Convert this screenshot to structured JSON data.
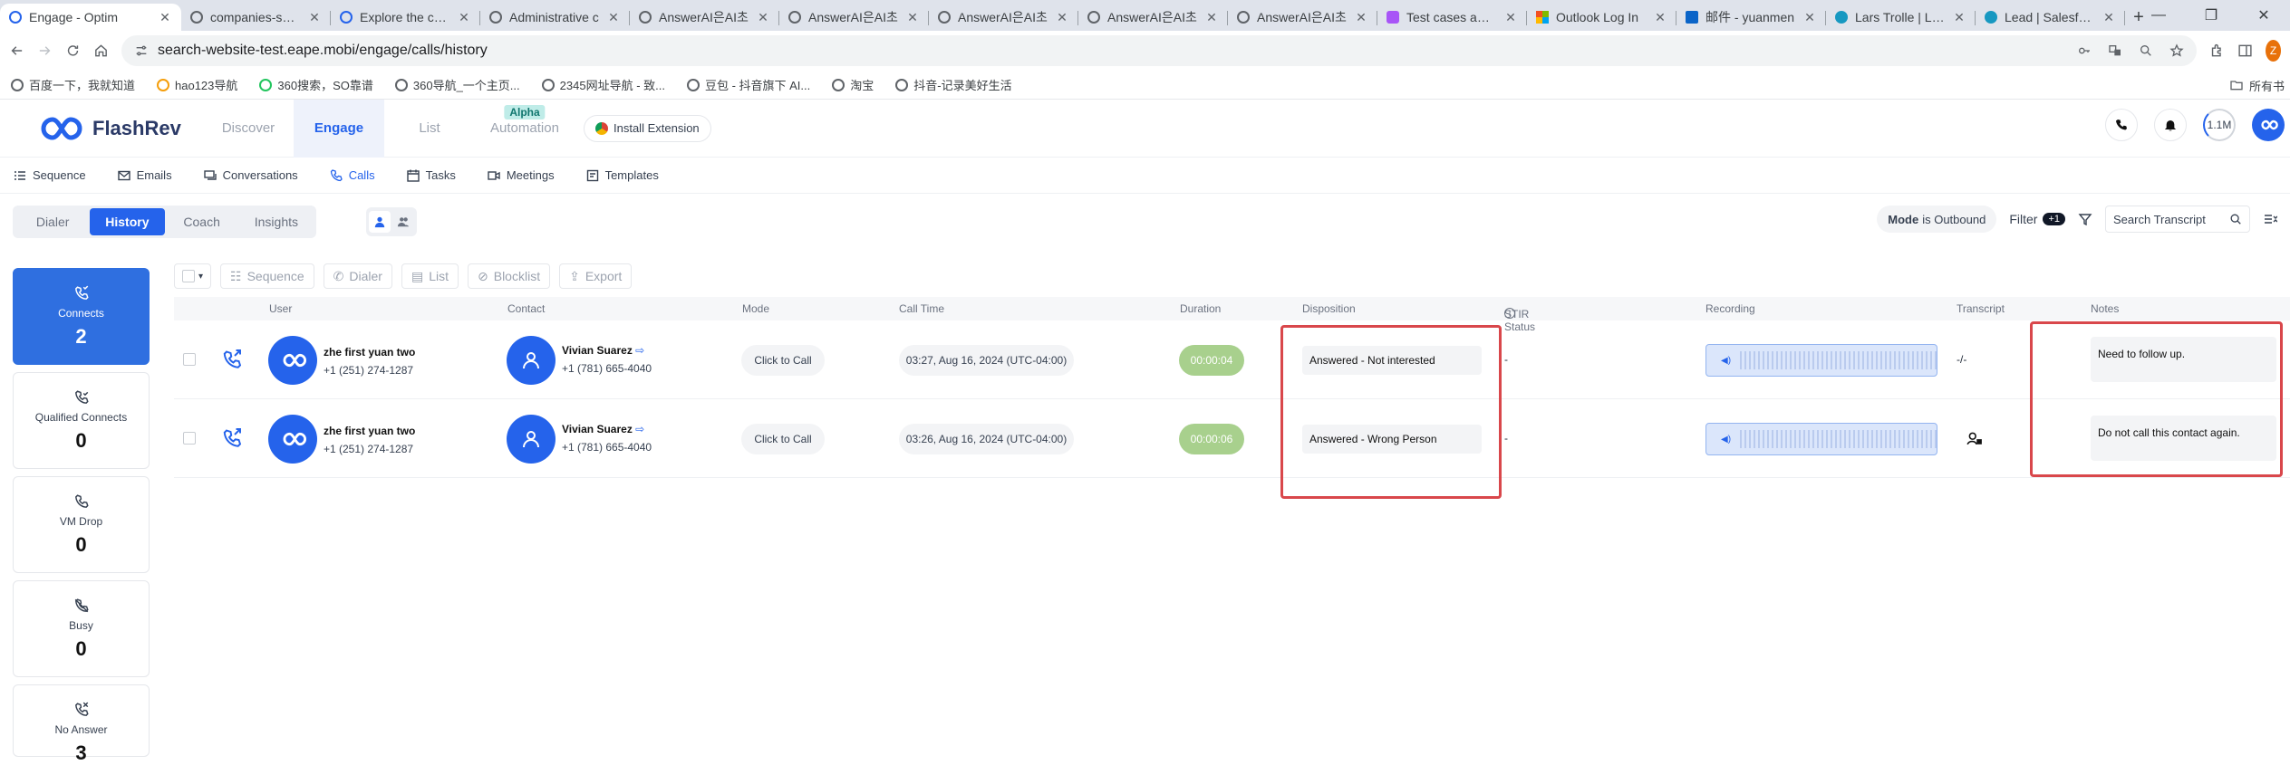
{
  "browser": {
    "tabs": [
      {
        "title": "Engage - Optim",
        "active": true
      },
      {
        "title": "companies-sear",
        "active": false
      },
      {
        "title": "Explore the com",
        "active": false
      },
      {
        "title": "Administrative c",
        "active": false
      },
      {
        "title": "AnswerAI은AI초",
        "active": false
      },
      {
        "title": "AnswerAI은AI초",
        "active": false
      },
      {
        "title": "AnswerAI은AI초",
        "active": false
      },
      {
        "title": "AnswerAI은AI초",
        "active": false
      },
      {
        "title": "AnswerAI은AI초",
        "active": false
      },
      {
        "title": "Test cases and 8",
        "active": false
      },
      {
        "title": "Outlook Log In",
        "active": false
      },
      {
        "title": "邮件 - yuanmen",
        "active": false
      },
      {
        "title": "Lars Trolle | Lea",
        "active": false
      },
      {
        "title": "Lead | Salesforc",
        "active": false
      }
    ],
    "url": "search-website-test.eape.mobi/engage/calls/history",
    "profile_initial": "Z",
    "bookmarks": [
      "百度一下，我就知道",
      "hao123导航",
      "360搜索，SO靠谱",
      "360导航_一个主页...",
      "2345网址导航 - 致...",
      "豆包 - 抖音旗下 AI...",
      "淘宝",
      "抖音-记录美好生活"
    ],
    "bookmarks_right": "所有书"
  },
  "app": {
    "logo_text": "FlashRev",
    "nav": [
      {
        "label": "Discover",
        "active": false
      },
      {
        "label": "Engage",
        "active": true
      },
      {
        "label": "List",
        "active": false
      },
      {
        "label": "Automation",
        "active": false,
        "badge": "Alpha"
      }
    ],
    "install_label": "Install Extension",
    "credits": "1.1M"
  },
  "subnav": [
    {
      "label": "Sequence",
      "icon": "list-icon"
    },
    {
      "label": "Emails",
      "icon": "mail-icon"
    },
    {
      "label": "Conversations",
      "icon": "chat-icon"
    },
    {
      "label": "Calls",
      "icon": "phone-icon",
      "active": true
    },
    {
      "label": "Tasks",
      "icon": "calendar-icon"
    },
    {
      "label": "Meetings",
      "icon": "video-icon"
    },
    {
      "label": "Templates",
      "icon": "template-icon"
    }
  ],
  "tabs": [
    {
      "label": "Dialer",
      "active": false
    },
    {
      "label": "History",
      "active": true
    },
    {
      "label": "Coach",
      "active": false
    },
    {
      "label": "Insights",
      "active": false
    }
  ],
  "toolbar": {
    "mode_key": "Mode",
    "mode_value": "is Outbound",
    "filter_label": "Filter",
    "filter_count": "+1",
    "search_placeholder": "Search Transcript"
  },
  "stats": [
    {
      "label": "Connects",
      "value": "2",
      "active": true
    },
    {
      "label": "Qualified Connects",
      "value": "0"
    },
    {
      "label": "VM Drop",
      "value": "0"
    },
    {
      "label": "Busy",
      "value": "0"
    },
    {
      "label": "No Answer",
      "value": "3"
    }
  ],
  "actions": [
    "Sequence",
    "Dialer",
    "List",
    "Blocklist",
    "Export"
  ],
  "columns": {
    "user": "User",
    "contact": "Contact",
    "mode": "Mode",
    "call_time": "Call Time",
    "duration": "Duration",
    "disposition": "Disposition",
    "stir": "STIR Status",
    "recording": "Recording",
    "transcript": "Transcript",
    "notes": "Notes"
  },
  "rows": [
    {
      "user_name": "zhe first yuan two",
      "user_phone": "+1 (251) 274-1287",
      "contact_name": "Vivian Suarez",
      "contact_phone": "+1 (781) 665-4040",
      "mode": "Click to Call",
      "call_time": "03:27, Aug 16, 2024 (UTC-04:00)",
      "duration": "00:00:04",
      "disposition": "Answered - Not interested",
      "stir": "-",
      "transcript": "-/-",
      "notes": "Need to follow up."
    },
    {
      "user_name": "zhe first yuan two",
      "user_phone": "+1 (251) 274-1287",
      "contact_name": "Vivian Suarez",
      "contact_phone": "+1 (781) 665-4040",
      "mode": "Click to Call",
      "call_time": "03:26, Aug 16, 2024 (UTC-04:00)",
      "duration": "00:00:06",
      "disposition": "Answered - Wrong Person",
      "stir": "-",
      "transcript": "",
      "notes": "Do not call this contact again."
    }
  ],
  "colors": {
    "accent": "#2563eb",
    "duration_pill": "#a8d08d",
    "highlight": "#d9474b"
  }
}
